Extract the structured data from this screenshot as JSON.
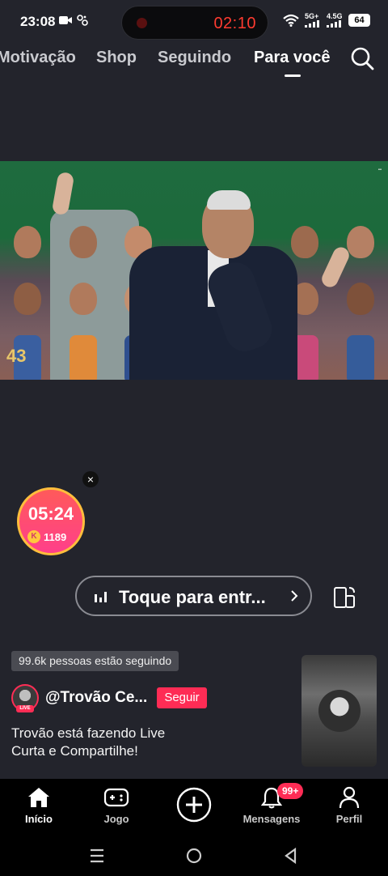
{
  "status_bar": {
    "time": "23:08",
    "record_timer": "02:10",
    "network_1": "5G+",
    "network_2": "4.5G",
    "battery": "64"
  },
  "top_nav": {
    "tabs": [
      {
        "label": "Motivação"
      },
      {
        "label": "Shop"
      },
      {
        "label": "Seguindo"
      },
      {
        "label": "Para você"
      }
    ],
    "active_tab": "Para você"
  },
  "video": {
    "anniversary_logo": "43"
  },
  "countdown": {
    "time": "05:24",
    "coins": "1189",
    "coin_symbol": "K",
    "close": "×"
  },
  "live_entry": {
    "label": "Toque para entr..."
  },
  "followers": {
    "text": "99.6k pessoas estão seguindo"
  },
  "host": {
    "name": "@Trovão Ce...",
    "live_tag": "LIVE",
    "follow_label": "Seguir",
    "description_line1": "Trovão está fazendo Live",
    "description_line2": "Curta e Compartilhe!"
  },
  "bottom_nav": {
    "items": [
      {
        "label": "Início",
        "icon": "home-icon"
      },
      {
        "label": "Jogo",
        "icon": "gamepad-icon"
      },
      {
        "label": "",
        "icon": "plus-icon"
      },
      {
        "label": "Mensagens",
        "icon": "bell-icon"
      },
      {
        "label": "Perfil",
        "icon": "person-icon"
      }
    ],
    "messages_badge": "99+"
  },
  "colors": {
    "accent": "#fe2c55",
    "background": "#23242c",
    "timer_red": "#ff3b30"
  }
}
